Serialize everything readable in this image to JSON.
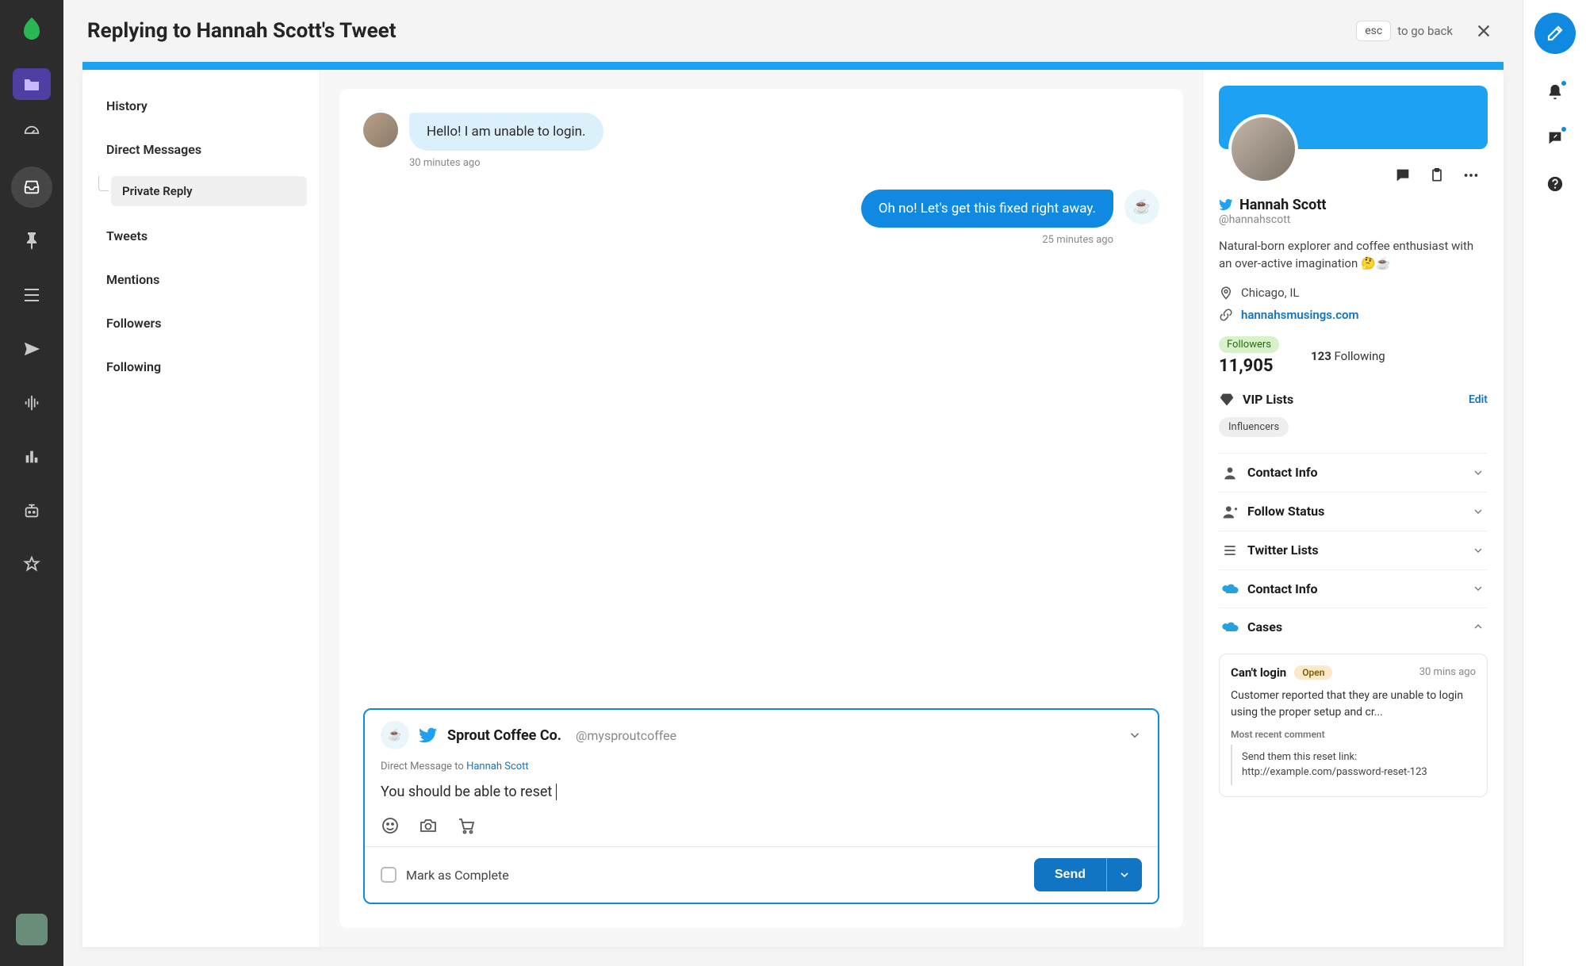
{
  "topbar": {
    "title": "Replying to Hannah Scott's Tweet",
    "esc_key": "esc",
    "esc_hint": "to go back"
  },
  "leftNav": {
    "history": "History",
    "direct_messages": "Direct Messages",
    "private_reply": "Private Reply",
    "tweets": "Tweets",
    "mentions": "Mentions",
    "followers": "Followers",
    "following": "Following"
  },
  "conversation": {
    "incoming": {
      "text": "Hello! I am unable to login.",
      "time": "30 minutes ago"
    },
    "outgoing": {
      "text": "Oh no! Let's get this fixed right away.",
      "time": "25 minutes ago"
    }
  },
  "composer": {
    "sender_name": "Sprout Coffee Co.",
    "sender_handle": "@mysproutcoffee",
    "dm_to_prefix": "Direct Message to ",
    "dm_to_name": "Hannah Scott",
    "draft": "You should be able to reset",
    "mark_complete": "Mark as Complete",
    "send": "Send"
  },
  "profile": {
    "name": "Hannah Scott",
    "handle": "@hannahscott",
    "bio": "Natural-born explorer and coffee enthusiast with an over-active imagination 🤔☕",
    "location": "Chicago, IL",
    "website": "hannahsmusings.com",
    "followers_label": "Followers",
    "followers_count": "11,905",
    "following_count": "123",
    "following_label": "Following",
    "vip_label": "VIP Lists",
    "edit": "Edit",
    "vip_chip": "Influencers"
  },
  "accordion": {
    "contact_info": "Contact Info",
    "follow_status": "Follow Status",
    "twitter_lists": "Twitter Lists",
    "sf_contact": "Contact Info",
    "sf_cases": "Cases"
  },
  "case": {
    "title": "Can't login",
    "status": "Open",
    "time": "30 mins ago",
    "body": "Customer reported that they are unable to login using the proper setup and cr...",
    "recent_label": "Most recent comment",
    "comment": "Send them this reset link: http://example.com/password-reset-123"
  }
}
